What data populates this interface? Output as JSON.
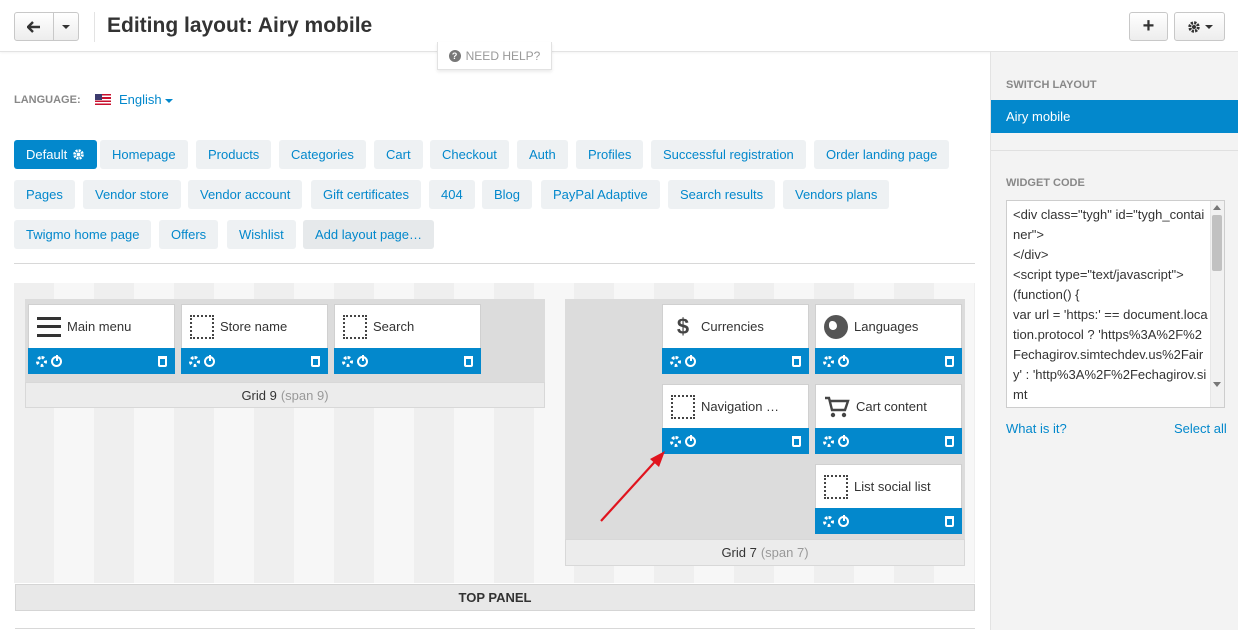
{
  "header": {
    "title": "Editing layout: Airy mobile",
    "help_label": "NEED HELP?"
  },
  "language": {
    "label": "LANGUAGE:",
    "value": "English"
  },
  "tabs": [
    {
      "label": "Default",
      "active": true
    },
    {
      "label": "Homepage"
    },
    {
      "label": "Products"
    },
    {
      "label": "Categories"
    },
    {
      "label": "Cart"
    },
    {
      "label": "Checkout"
    },
    {
      "label": "Auth"
    },
    {
      "label": "Profiles"
    },
    {
      "label": "Successful registration"
    },
    {
      "label": "Order landing page"
    },
    {
      "label": "Pages"
    },
    {
      "label": "Vendor store"
    },
    {
      "label": "Vendor account"
    },
    {
      "label": "Gift certificates"
    },
    {
      "label": "404"
    },
    {
      "label": "Blog"
    },
    {
      "label": "PayPal Adaptive"
    },
    {
      "label": "Search results"
    },
    {
      "label": "Vendors plans"
    },
    {
      "label": "Twigmo home page"
    },
    {
      "label": "Offers"
    },
    {
      "label": "Wishlist"
    },
    {
      "label": "Add layout page…"
    }
  ],
  "grid9": {
    "name": "Grid 9",
    "span": "(span 9)",
    "blocks": [
      {
        "label": "Main menu",
        "icon": "menu-icon"
      },
      {
        "label": "Store name",
        "icon": "dotted-box-icon"
      },
      {
        "label": "Search",
        "icon": "dotted-box-icon"
      }
    ]
  },
  "grid7": {
    "name": "Grid 7",
    "span": "(span 7)",
    "blocks": [
      {
        "label": "Currencies",
        "icon": "dollar-icon"
      },
      {
        "label": "Languages",
        "icon": "globe-icon"
      },
      {
        "label": "Navigation …",
        "icon": "dotted-box-icon"
      },
      {
        "label": "Cart content",
        "icon": "cart-icon"
      },
      {
        "label": "List social list",
        "icon": "dotted-box-icon"
      }
    ]
  },
  "top_panel": "TOP PANEL",
  "sidebar": {
    "switch_label": "SWITCH LAYOUT",
    "current_layout": "Airy mobile",
    "widget_label": "WIDGET CODE",
    "widget_code": "<div class=\"tygh\" id=\"tygh_container\">\n</div>\n<script type=\"text/javascript\">\n(function() {\nvar url = 'https:' == document.location.protocol ? 'https%3A%2F%2Fechagirov.simtechdev.us%2Fairy' : 'http%3A%2F%2Fechagirov.simt",
    "what_link": "What is it?",
    "select_all": "Select all"
  },
  "colors": {
    "accent": "#0388cc",
    "arrow": "#e0141e"
  }
}
